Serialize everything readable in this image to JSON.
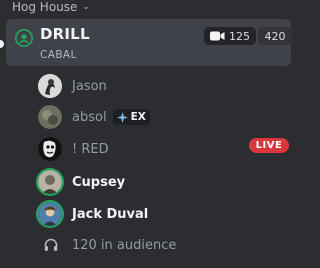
{
  "category": {
    "label": "Hog House",
    "chevron_icon": "chevron-down-icon"
  },
  "channel": {
    "icon": "stage-icon",
    "name": "DRILL",
    "topic": "CABAL",
    "video_icon": "video-camera-icon",
    "video_count": "125",
    "listener_count": "420"
  },
  "members": [
    {
      "name": "Jason",
      "avatar": "avatar-jason",
      "speaking": false
    },
    {
      "name": "absol",
      "avatar": "avatar-absol",
      "speaking": false,
      "badge": {
        "icon": "sparkle-icon",
        "label": "EX"
      }
    },
    {
      "name": "! RED",
      "avatar": "avatar-red",
      "speaking": false,
      "live": "LIVE"
    },
    {
      "name": "Cupsey",
      "avatar": "avatar-cupsey",
      "speaking": true
    },
    {
      "name": "Jack Duval",
      "avatar": "avatar-jack-duval",
      "speaking": true
    }
  ],
  "audience": {
    "icon": "headphones-icon",
    "label": "120 in audience"
  },
  "colors": {
    "background": "#2b2d31",
    "selected": "#404249",
    "speaking_ring": "#23a55a",
    "live": "#da373c",
    "stage_icon": "#23a55a"
  }
}
